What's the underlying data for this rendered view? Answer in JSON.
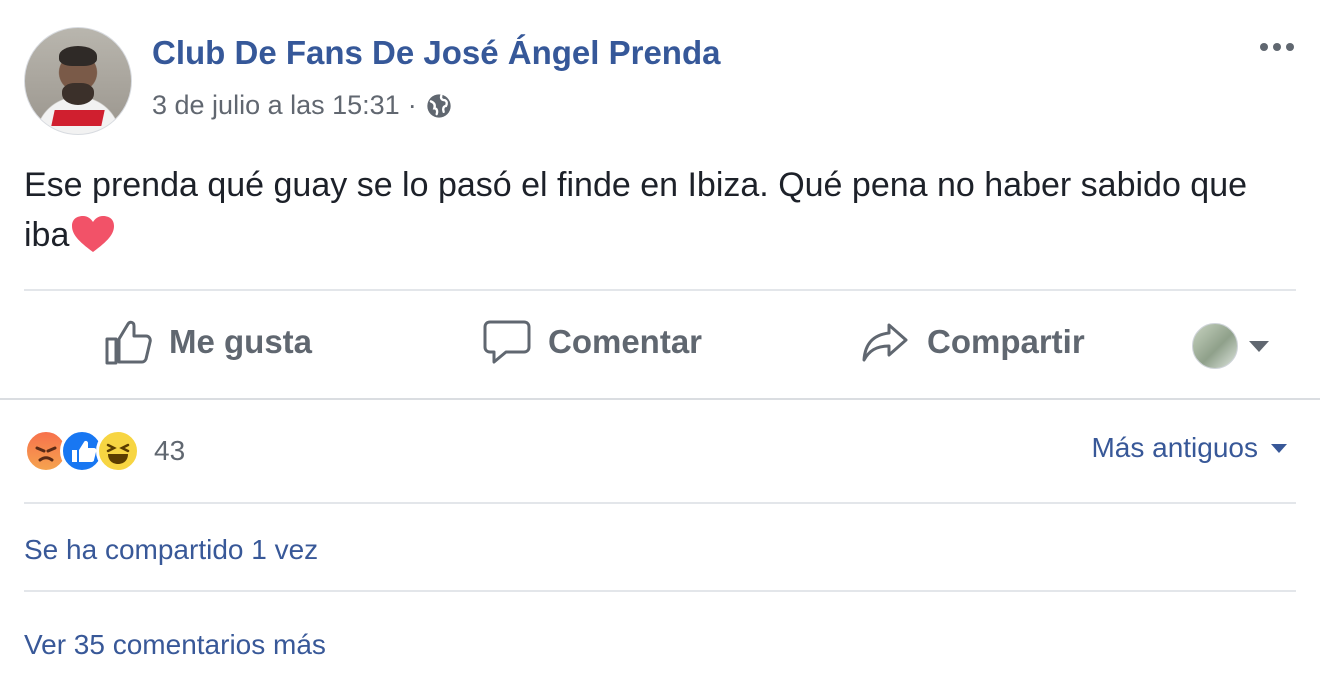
{
  "post": {
    "page_name": "Club De Fans De José Ángel Prenda",
    "timestamp": "3 de julio a las 15:31",
    "separator": "·",
    "audience_icon": "globe-icon",
    "text_main": "Ese prenda qué guay se lo pasó el finde en Ibiza. Qué pena no haber sabido que iba"
  },
  "actions": {
    "like_label": "Me gusta",
    "comment_label": "Comentar",
    "share_label": "Compartir"
  },
  "reactions": {
    "types": [
      "angry",
      "like",
      "haha"
    ],
    "count": "43"
  },
  "comments": {
    "order_label": "Más antiguos",
    "shared_label": "Se ha compartido 1 vez",
    "more_comments_label": "Ver 35 comentarios más"
  },
  "colors": {
    "link": "#365899",
    "muted": "#606770",
    "like_blue": "#1877f2",
    "heart": "#f25268"
  }
}
